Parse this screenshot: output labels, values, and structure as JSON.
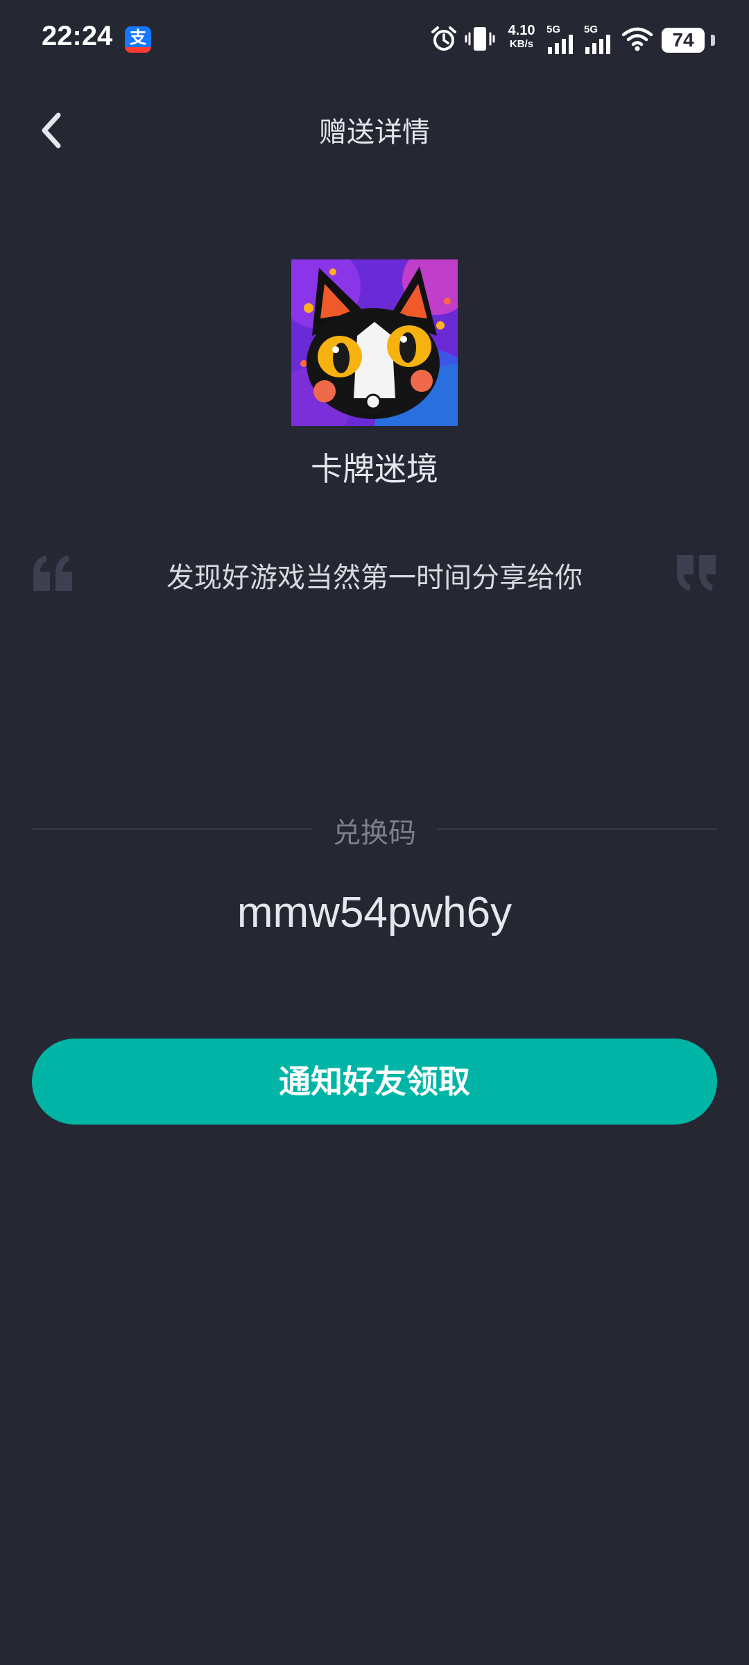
{
  "status_bar": {
    "time": "22:24",
    "app_badge_icon": "alipay-icon",
    "net_speed_value": "4.10",
    "net_speed_unit": "KB/s",
    "sim1_label": "5G",
    "sim2_label": "5G",
    "battery_level": "74",
    "icons": [
      "alarm-icon",
      "vibrate-icon",
      "signal-icon",
      "signal-icon",
      "wifi-icon",
      "battery-icon"
    ]
  },
  "header": {
    "title": "赠送详情",
    "back_icon": "chevron-left-icon"
  },
  "game": {
    "name": "卡牌迷境",
    "cover_icon": "cat-artwork-icon"
  },
  "message": {
    "text": "发现好游戏当然第一时间分享给你"
  },
  "redeem": {
    "label": "兑换码",
    "code": "mmw54pwh6y"
  },
  "actions": {
    "notify_label": "通知好友领取"
  },
  "colors": {
    "background": "#252733",
    "accent": "#00b5a6",
    "text_primary": "#e6e7ec",
    "text_secondary": "#7d808c"
  }
}
